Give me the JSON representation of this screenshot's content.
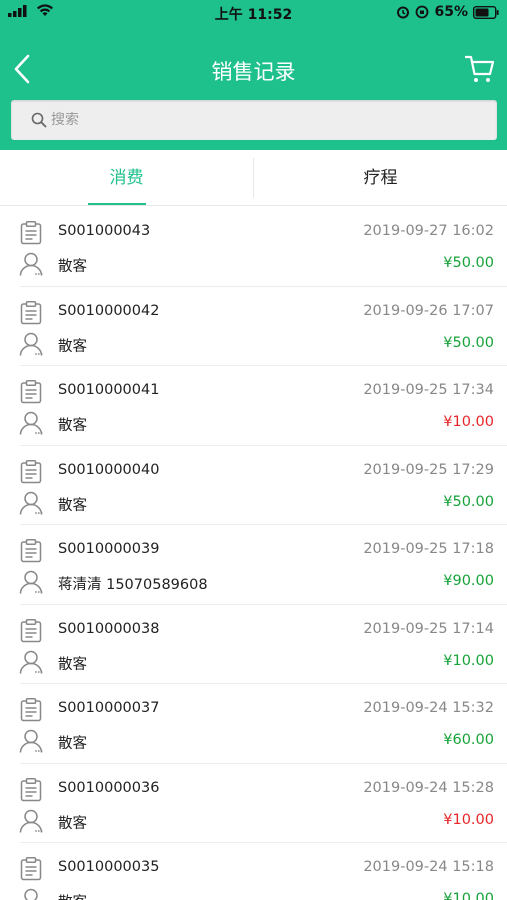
{
  "status_bar": {
    "time": "上午 11:52",
    "battery": "65%"
  },
  "nav": {
    "title": "销售记录"
  },
  "search": {
    "placeholder": "搜索",
    "value": ""
  },
  "tabs": [
    {
      "label": "消费",
      "active": true
    },
    {
      "label": "疗程",
      "active": false
    }
  ],
  "colors": {
    "accent": "#1ec08c",
    "amount_green": "#17a33a",
    "amount_red": "#e8262a"
  },
  "records": [
    {
      "order_no": "S001000043",
      "time": "2019-09-27 16:02",
      "customer": "散客",
      "amount": "¥50.00",
      "amount_color": "green"
    },
    {
      "order_no": "S0010000042",
      "time": "2019-09-26 17:07",
      "customer": "散客",
      "amount": "¥50.00",
      "amount_color": "green"
    },
    {
      "order_no": "S0010000041",
      "time": "2019-09-25 17:34",
      "customer": "散客",
      "amount": "¥10.00",
      "amount_color": "red"
    },
    {
      "order_no": "S0010000040",
      "time": "2019-09-25 17:29",
      "customer": "散客",
      "amount": "¥50.00",
      "amount_color": "green"
    },
    {
      "order_no": "S0010000039",
      "time": "2019-09-25 17:18",
      "customer": "蒋清清  15070589608",
      "amount": "¥90.00",
      "amount_color": "green"
    },
    {
      "order_no": "S0010000038",
      "time": "2019-09-25 17:14",
      "customer": "散客",
      "amount": "¥10.00",
      "amount_color": "green"
    },
    {
      "order_no": "S0010000037",
      "time": "2019-09-24 15:32",
      "customer": "散客",
      "amount": "¥60.00",
      "amount_color": "green"
    },
    {
      "order_no": "S0010000036",
      "time": "2019-09-24 15:28",
      "customer": "散客",
      "amount": "¥10.00",
      "amount_color": "red"
    },
    {
      "order_no": "S0010000035",
      "time": "2019-09-24 15:18",
      "customer": "散客",
      "amount": "¥10.00",
      "amount_color": "green"
    }
  ]
}
